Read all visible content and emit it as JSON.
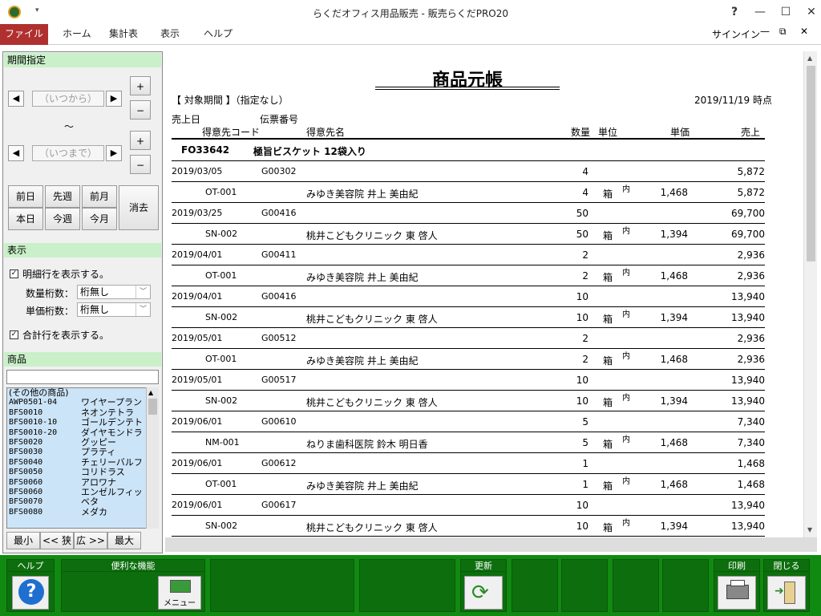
{
  "window": {
    "title": "らくだオフィス用品販売 - 販売らくだPRO20",
    "help": "?",
    "signin": "サインイン"
  },
  "menu": [
    "ファイル",
    "ホーム",
    "集計表",
    "表示",
    "ヘルプ"
  ],
  "left": {
    "period_header": "期間指定",
    "from_placeholder": "（いつから）",
    "to_placeholder": "（いつまで）",
    "tilde": "〜",
    "plus": "+",
    "minus": "−",
    "quick": [
      "前日",
      "先週",
      "前月",
      "本日",
      "今週",
      "今月"
    ],
    "clear": "消去",
    "display_header": "表示",
    "show_detail": "明細行を表示する。",
    "qty_digits_label": "数量桁数：",
    "qty_digits_value": "桁無し",
    "price_digits_label": "単価桁数：",
    "price_digits_value": "桁無し",
    "show_total": "合計行を表示する。",
    "product_header": "商品",
    "products": [
      {
        "code": "(その他の商品)",
        "name": ""
      },
      {
        "code": "AWP0501-04",
        "name": "ワイヤープラン"
      },
      {
        "code": "BFS0010",
        "name": "ネオンテトラ"
      },
      {
        "code": "BFS0010-10",
        "name": "ゴールデンテト"
      },
      {
        "code": "BFS0010-20",
        "name": "ダイヤモンドラ"
      },
      {
        "code": "BFS0020",
        "name": "グッピー"
      },
      {
        "code": "BFS0030",
        "name": "プラティ"
      },
      {
        "code": "BFS0040",
        "name": "チェリーバルフ"
      },
      {
        "code": "BFS0050",
        "name": "コリドラス"
      },
      {
        "code": "BFS0060",
        "name": "アロワナ"
      },
      {
        "code": "BFS0060",
        "name": "エンゼルフィッ"
      },
      {
        "code": "BFS0070",
        "name": "ベタ"
      },
      {
        "code": "BFS0080",
        "name": "メダカ"
      }
    ],
    "zoom": [
      "最小",
      "<< 狭",
      "広 >>",
      "最大"
    ]
  },
  "report": {
    "title": "商品元帳",
    "period": "【 対象期間 】（指定なし）",
    "asof": "2019/11/19 時点",
    "h1": {
      "date": "売上日",
      "slip": "伝票番号"
    },
    "h2": {
      "cust_code": "得意先コード",
      "cust_name": "得意先名",
      "qty": "数量",
      "unit": "単位",
      "price": "単価",
      "amount": "売上"
    },
    "product": {
      "code": "FO33642",
      "name": "極旨ビスケット 12袋入り"
    },
    "rows": [
      {
        "type": "d",
        "date": "2019/03/05",
        "slip": "G00302",
        "qty": "4",
        "amount": "5,872"
      },
      {
        "type": "c",
        "code": "OT-001",
        "name": "みゆき美容院 井上 美由紀",
        "qty": "4",
        "unit": "箱",
        "tax": "内",
        "price": "1,468",
        "amount": "5,872"
      },
      {
        "type": "d",
        "date": "2019/03/25",
        "slip": "G00416",
        "qty": "50",
        "amount": "69,700"
      },
      {
        "type": "c",
        "code": "SN-002",
        "name": "桃井こどもクリニック 東 啓人",
        "qty": "50",
        "unit": "箱",
        "tax": "内",
        "price": "1,394",
        "amount": "69,700"
      },
      {
        "type": "d",
        "date": "2019/04/01",
        "slip": "G00411",
        "qty": "2",
        "amount": "2,936"
      },
      {
        "type": "c",
        "code": "OT-001",
        "name": "みゆき美容院 井上 美由紀",
        "qty": "2",
        "unit": "箱",
        "tax": "内",
        "price": "1,468",
        "amount": "2,936"
      },
      {
        "type": "d",
        "date": "2019/04/01",
        "slip": "G00416",
        "qty": "10",
        "amount": "13,940"
      },
      {
        "type": "c",
        "code": "SN-002",
        "name": "桃井こどもクリニック 東 啓人",
        "qty": "10",
        "unit": "箱",
        "tax": "内",
        "price": "1,394",
        "amount": "13,940"
      },
      {
        "type": "d",
        "date": "2019/05/01",
        "slip": "G00512",
        "qty": "2",
        "amount": "2,936"
      },
      {
        "type": "c",
        "code": "OT-001",
        "name": "みゆき美容院 井上 美由紀",
        "qty": "2",
        "unit": "箱",
        "tax": "内",
        "price": "1,468",
        "amount": "2,936"
      },
      {
        "type": "d",
        "date": "2019/05/01",
        "slip": "G00517",
        "qty": "10",
        "amount": "13,940"
      },
      {
        "type": "c",
        "code": "SN-002",
        "name": "桃井こどもクリニック 東 啓人",
        "qty": "10",
        "unit": "箱",
        "tax": "内",
        "price": "1,394",
        "amount": "13,940"
      },
      {
        "type": "d",
        "date": "2019/06/01",
        "slip": "G00610",
        "qty": "5",
        "amount": "7,340"
      },
      {
        "type": "c",
        "code": "NM-001",
        "name": "ねりま歯科医院 鈴木 明日香",
        "qty": "5",
        "unit": "箱",
        "tax": "内",
        "price": "1,468",
        "amount": "7,340"
      },
      {
        "type": "d",
        "date": "2019/06/01",
        "slip": "G00612",
        "qty": "1",
        "amount": "1,468"
      },
      {
        "type": "c",
        "code": "OT-001",
        "name": "みゆき美容院 井上 美由紀",
        "qty": "1",
        "unit": "箱",
        "tax": "内",
        "price": "1,468",
        "amount": "1,468"
      },
      {
        "type": "d",
        "date": "2019/06/01",
        "slip": "G00617",
        "qty": "10",
        "amount": "13,940"
      },
      {
        "type": "c",
        "code": "SN-002",
        "name": "桃井こどもクリニック 東 啓人",
        "qty": "10",
        "unit": "箱",
        "tax": "内",
        "price": "1,394",
        "amount": "13,940"
      }
    ]
  },
  "bottom": {
    "help": "ヘルプ",
    "tools": "便利な機能",
    "menu": "メニュー",
    "refresh": "更新",
    "print": "印刷",
    "close": "閉じる"
  }
}
